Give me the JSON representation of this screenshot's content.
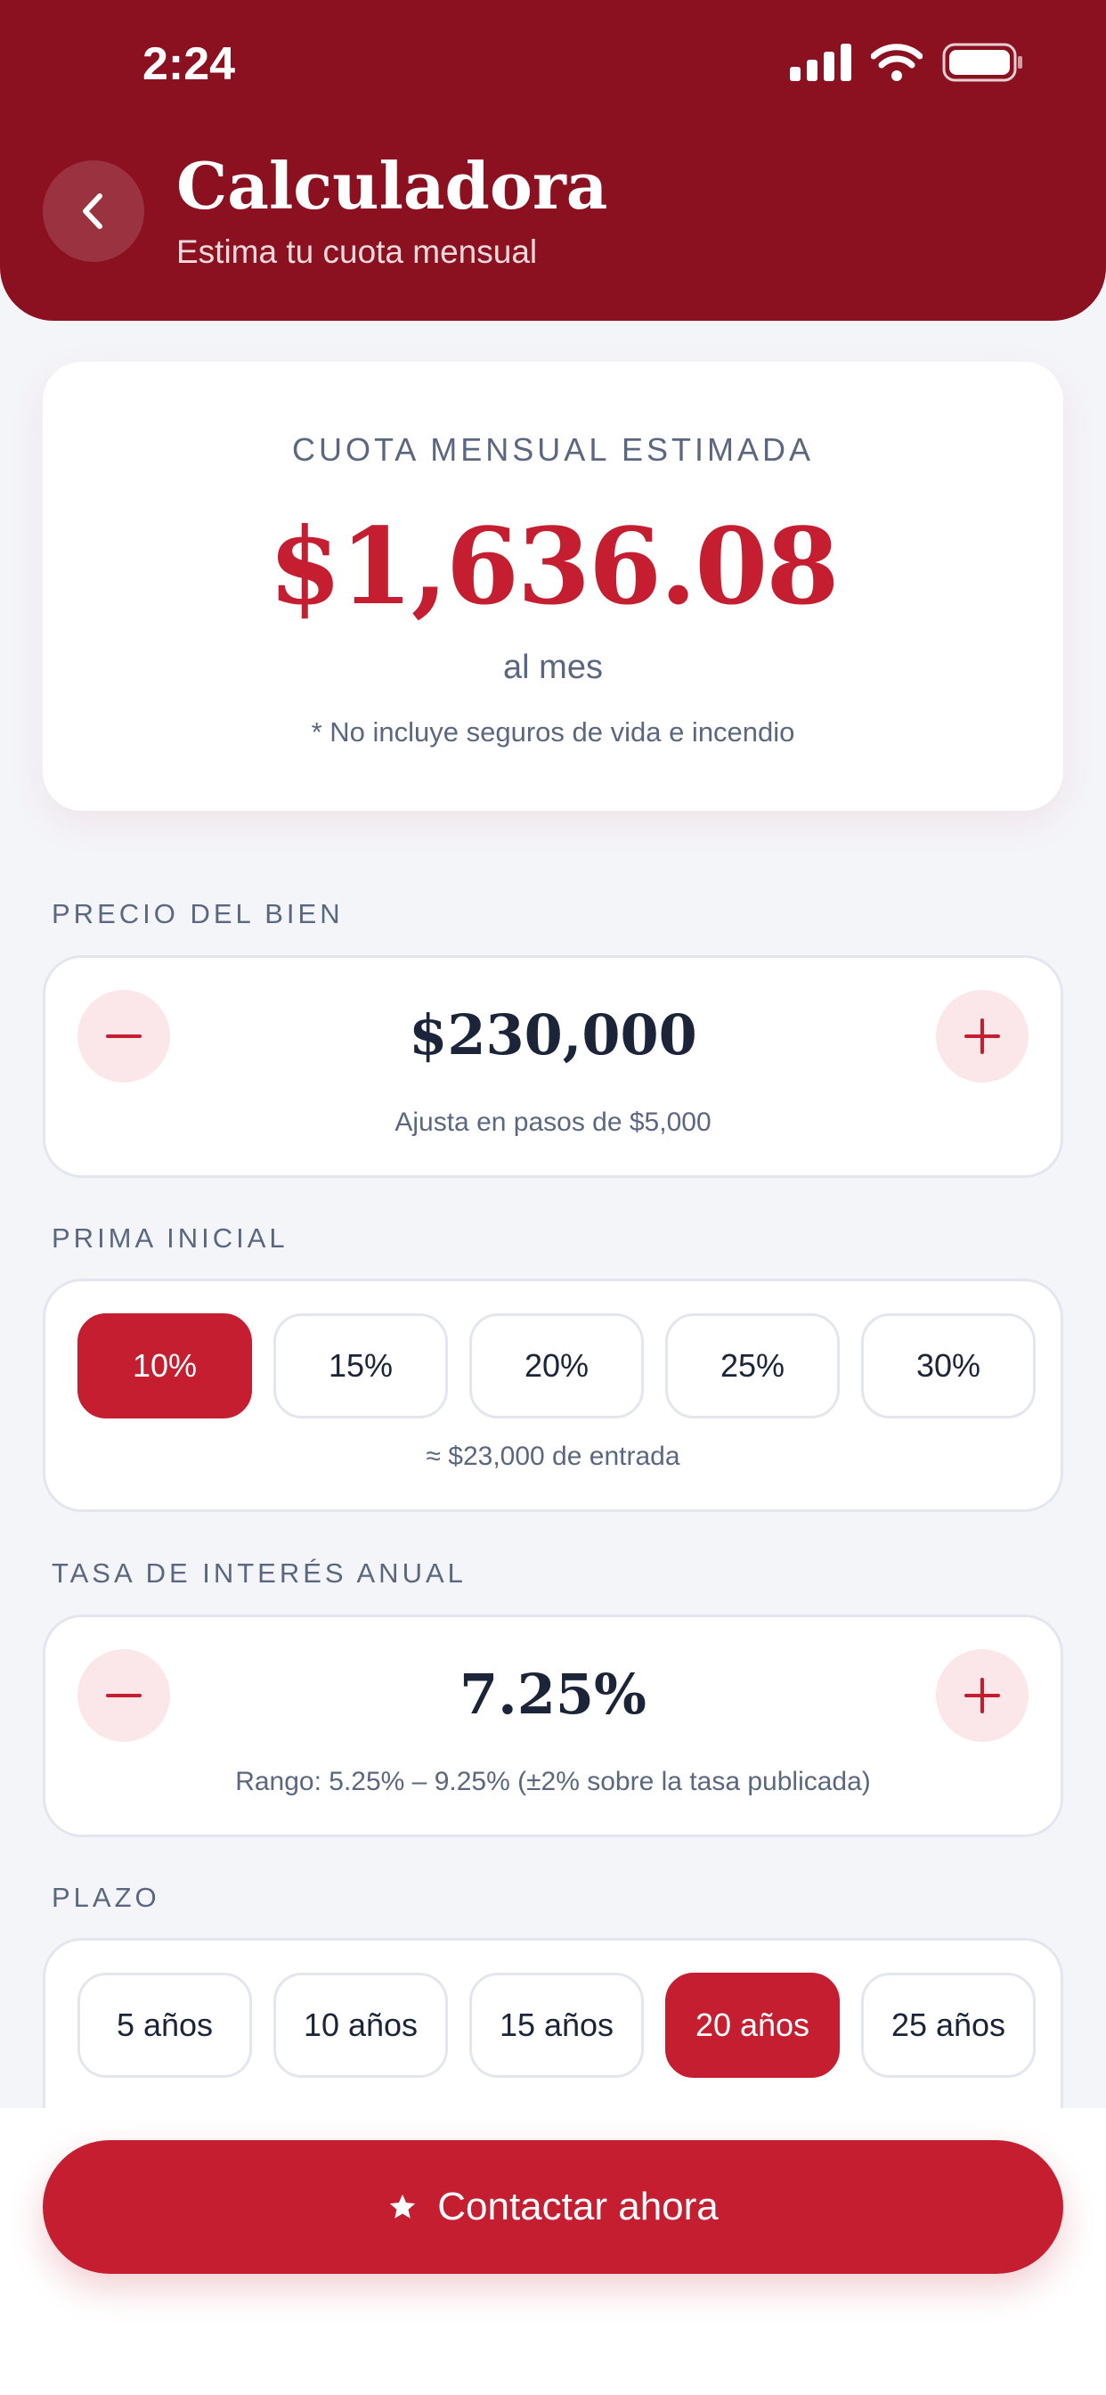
{
  "status_bar": {
    "time": "2:24"
  },
  "header": {
    "title": "Calculadora",
    "subtitle": "Estima tu cuota mensual"
  },
  "result": {
    "label": "CUOTA MENSUAL ESTIMADA",
    "amount": "$1,636.08",
    "period": "al mes",
    "note": "* No incluye seguros de vida e incendio"
  },
  "price": {
    "label": "PRECIO DEL BIEN",
    "value": "$230,000",
    "hint": "Ajusta en pasos de $5,000"
  },
  "down_payment": {
    "label": "PRIMA INICIAL",
    "options": [
      "10%",
      "15%",
      "20%",
      "25%",
      "30%"
    ],
    "selected": "10%",
    "hint": "≈ $23,000 de entrada"
  },
  "interest": {
    "label": "TASA DE INTERÉS ANUAL",
    "value": "7.25%",
    "hint": "Rango: 5.25% – 9.25% (±2% sobre la tasa publicada)"
  },
  "term": {
    "label": "PLAZO",
    "options": [
      "5 años",
      "10 años",
      "15 años",
      "20 años",
      "25 años"
    ],
    "selected": "20 años"
  },
  "cta": {
    "label": "Contactar ahora",
    "icon": "star-icon"
  },
  "colors": {
    "header": "#8b1120",
    "accent": "#c41e30",
    "text_dark": "#1b2438",
    "text_muted": "#5b6780"
  }
}
